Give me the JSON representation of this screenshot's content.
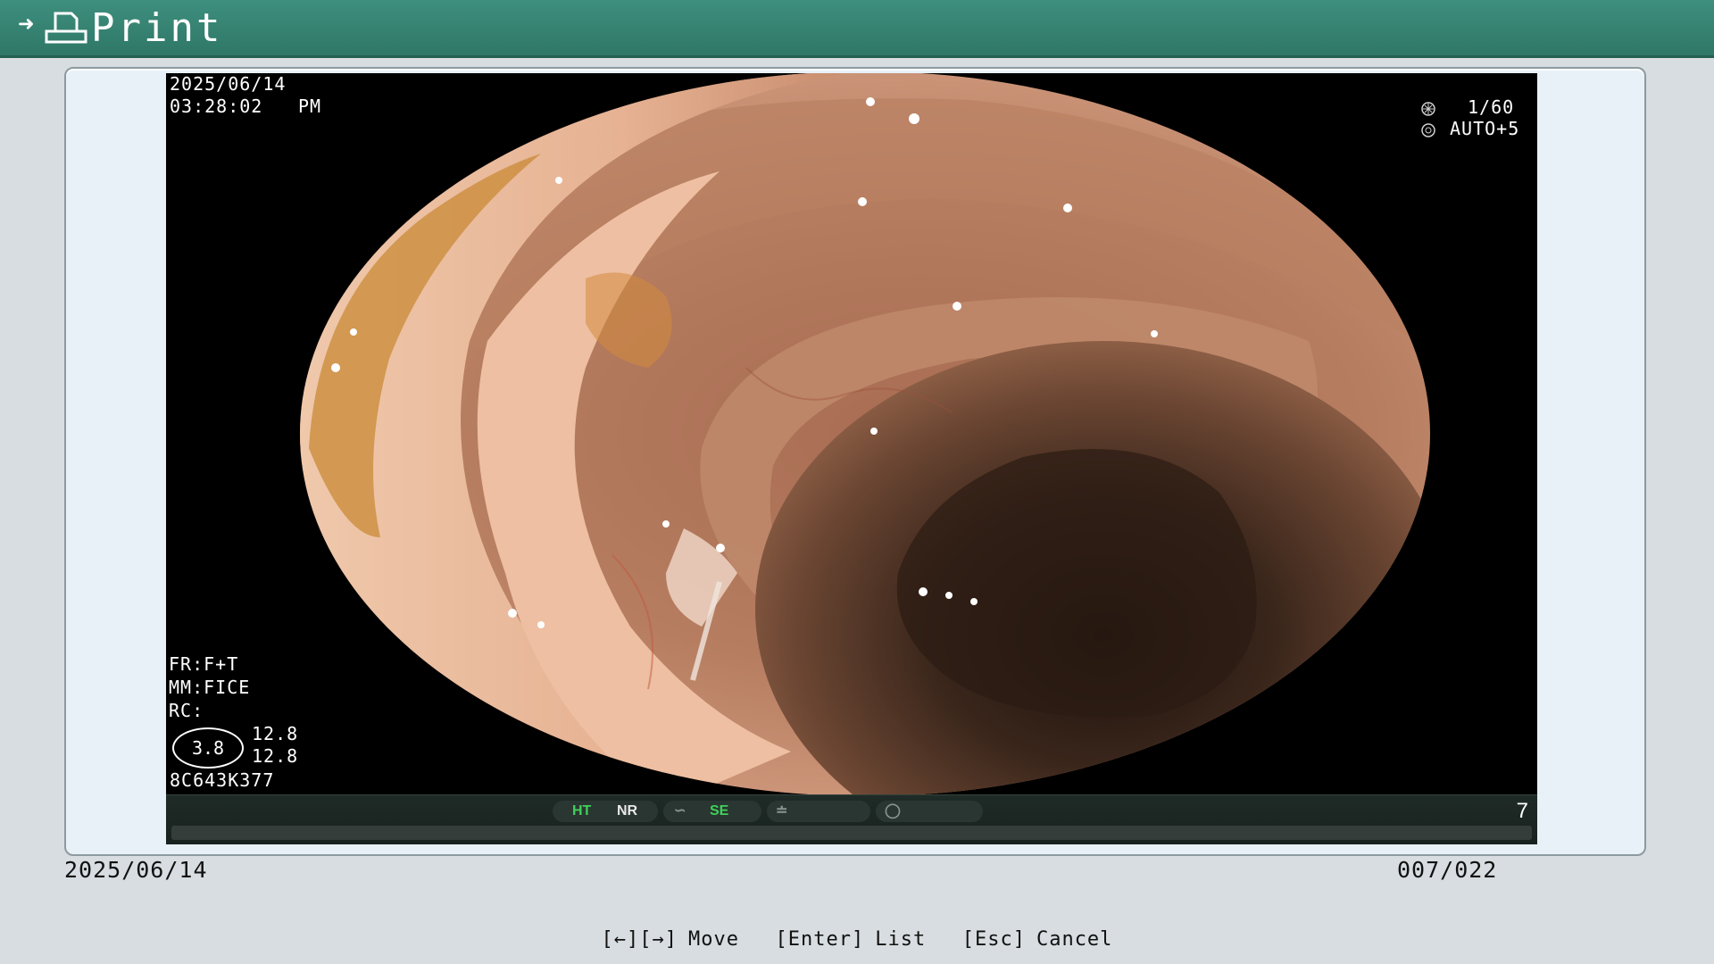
{
  "title_bar": {
    "title": "Print",
    "icon": "printer-icon"
  },
  "image_overlay": {
    "date": "2025/06/14",
    "time": "03:28:02",
    "ampm": "PM",
    "shutter": "1/60",
    "iris": "AUTO+5",
    "fr": "FR:F+T",
    "mm": "MM:FICE",
    "rc": "RC:",
    "zoom_value": "3.8",
    "value_top": "12.8",
    "value_bottom": "12.8",
    "scope_id": "8C643K377"
  },
  "status_bar": {
    "ht": "HT",
    "nr": "NR",
    "se": "SE",
    "frame_number": "7"
  },
  "footer": {
    "date": "2025/06/14",
    "counter": "007/022",
    "help": {
      "move_keys": "[←][→]",
      "move_label": "Move",
      "list_key": "[Enter]",
      "list_label": "List",
      "cancel_key": "[Esc]",
      "cancel_label": "Cancel"
    }
  },
  "colors": {
    "title_bar": "#2f7767",
    "status_green": "#3fd05a",
    "background": "#d7dde0"
  }
}
